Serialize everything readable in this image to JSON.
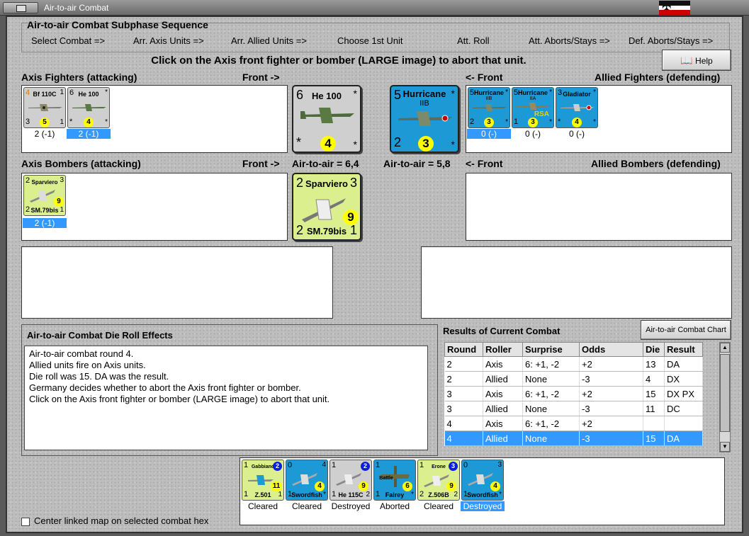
{
  "window": {
    "title": "Air-to-air Combat"
  },
  "phase": {
    "title": "Air-to-air Combat Subphase Sequence",
    "steps": [
      "Select Combat =>",
      "Arr. Axis Units =>",
      "Arr. Allied Units =>",
      "Choose 1st Unit",
      "Att. Roll",
      "Att. Aborts/Stays =>",
      "Def. Aborts/Stays =>"
    ]
  },
  "instruction": "Click on the Axis front fighter or bomber  (LARGE image) to abort that unit.",
  "help_label": "Help",
  "labels": {
    "axis_fighters": "Axis Fighters (attacking)",
    "front_right": "Front ->",
    "front_left": "<- Front",
    "allied_fighters": "Allied Fighters (defending)",
    "axis_bombers": "Axis Bombers (attacking)",
    "air_axis": "Air-to-air = 6,4",
    "air_allied": "Air-to-air = 5,8",
    "allied_bombers": "Allied Bombers (defending)"
  },
  "axis_fighters": [
    {
      "name": "Bf 110C",
      "tl": "4",
      "tr": "1",
      "bl": "3",
      "br": "1",
      "circle": "5",
      "caption": "2 (-1)",
      "selected": false
    },
    {
      "name": "He 100",
      "tl": "6",
      "tr": "*",
      "bl": "*",
      "br": "*",
      "circle": "4",
      "caption": "2 (-1)",
      "selected": true
    }
  ],
  "allied_fighters": [
    {
      "name": "Hurricane",
      "sub": "IIB",
      "tl": "5",
      "tr": "*",
      "bl": "2",
      "br": "*",
      "circle": "3",
      "caption": "0 (-)",
      "selected": true
    },
    {
      "name": "Hurricane",
      "sub": "IIA",
      "tag": "RSA",
      "tl": "5",
      "tr": "*",
      "bl": "1",
      "br": "*",
      "circle": "3",
      "caption": "0 (-)",
      "selected": false
    },
    {
      "name": "Gladiator",
      "tl": "3",
      "tr": "*",
      "bl": "*",
      "br": "*",
      "circle": "4",
      "caption": "0 (-)",
      "selected": false
    }
  ],
  "axis_bombers": [
    {
      "name": "Sparviero",
      "bottom_name": "SM.79bis",
      "tl": "2",
      "tr": "3",
      "bl": "2",
      "br": "1",
      "circle": "9",
      "caption": "2 (-1)",
      "selected": true
    }
  ],
  "front_axis_fighter": {
    "name": "He 100",
    "tl": "6",
    "tr": "*",
    "bl": "*",
    "br": "*",
    "circle": "4"
  },
  "front_allied_fighter": {
    "name": "Hurricane",
    "sub": "IIB",
    "tl": "5",
    "tr": "*",
    "bl": "2",
    "br": "*",
    "circle": "3"
  },
  "front_axis_bomber": {
    "name": "Sparviero",
    "bottom_name": "SM.79bis",
    "tl": "2",
    "tr": "3",
    "bl": "2",
    "br": "1",
    "circle": "9"
  },
  "die_roll": {
    "title": "Air-to-air Combat Die Roll Effects",
    "lines": [
      "Air-to-air combat round 4.",
      "Allied units fire on Axis units.",
      "Die roll was 15.  DA was the result.",
      "Germany decides whether to abort the Axis front fighter or bomber.",
      "Click on the Axis front fighter or bomber  (LARGE image) to abort that unit."
    ]
  },
  "results": {
    "title": "Results of Current Combat",
    "chart_button": "Air-to-air Combat Chart",
    "columns": [
      "Round",
      "Roller",
      "Surprise",
      "Odds",
      "Die",
      "Result"
    ],
    "rows": [
      [
        "2",
        "Axis",
        "6: +1, -2",
        "+2",
        "13",
        "DA"
      ],
      [
        "2",
        "Allied",
        "None",
        "-3",
        "4",
        "DX"
      ],
      [
        "3",
        "Axis",
        "6: +1, -2",
        "+2",
        "15",
        "DX PX"
      ],
      [
        "3",
        "Allied",
        "None",
        "-3",
        "11",
        "DC"
      ],
      [
        "4",
        "Axis",
        "6: +1, -2",
        "+2",
        "",
        ""
      ],
      [
        "4",
        "Allied",
        "None",
        "-3",
        "15",
        "DA"
      ]
    ],
    "selected_row": 5
  },
  "checkbox_label": "Center linked map on selected combat hex",
  "bottom_units": [
    {
      "name": "Gabbiano",
      "bottom_name": "Z.501",
      "tl": "1",
      "badge": "2",
      "bl": "1",
      "br": "1",
      "circle": "11",
      "color": "lime",
      "caption": "Cleared",
      "selected": false
    },
    {
      "name": "",
      "bottom_name": "Swordfish",
      "tl": "0",
      "badge": "4",
      "bl": "1",
      "br": "*",
      "circle": "4",
      "color": "blue",
      "caption": "Cleared",
      "selected": false
    },
    {
      "name": "",
      "bottom_name": "He 115C",
      "tl": "1",
      "badge": "2",
      "bl": "1",
      "br": "2",
      "circle": "9",
      "color": "grey",
      "caption": "Destroyed",
      "selected": false
    },
    {
      "name": "Battle",
      "bottom_name": "Fairey",
      "tl": "1",
      "badge": "",
      "bl": "1",
      "br": "*",
      "circle": "6",
      "color": "blue",
      "caption": "Aborted",
      "selected": false
    },
    {
      "name": "Erone",
      "bottom_name": "Z.506B",
      "tl": "1",
      "badge": "3",
      "bl": "2",
      "br": "2",
      "circle": "9",
      "color": "lime",
      "caption": "Cleared",
      "selected": false
    },
    {
      "name": "",
      "bottom_name": "Swordfish",
      "tl": "0",
      "badge": "3",
      "bl": "1",
      "br": "*",
      "circle": "4",
      "color": "blue",
      "caption": "Destroyed",
      "selected": true
    }
  ],
  "colors": {
    "counter_blue": "#1d9ad6",
    "counter_lime": "#dcef8e",
    "counter_grey": "#cfcfcf",
    "selection": "#3399ff"
  }
}
